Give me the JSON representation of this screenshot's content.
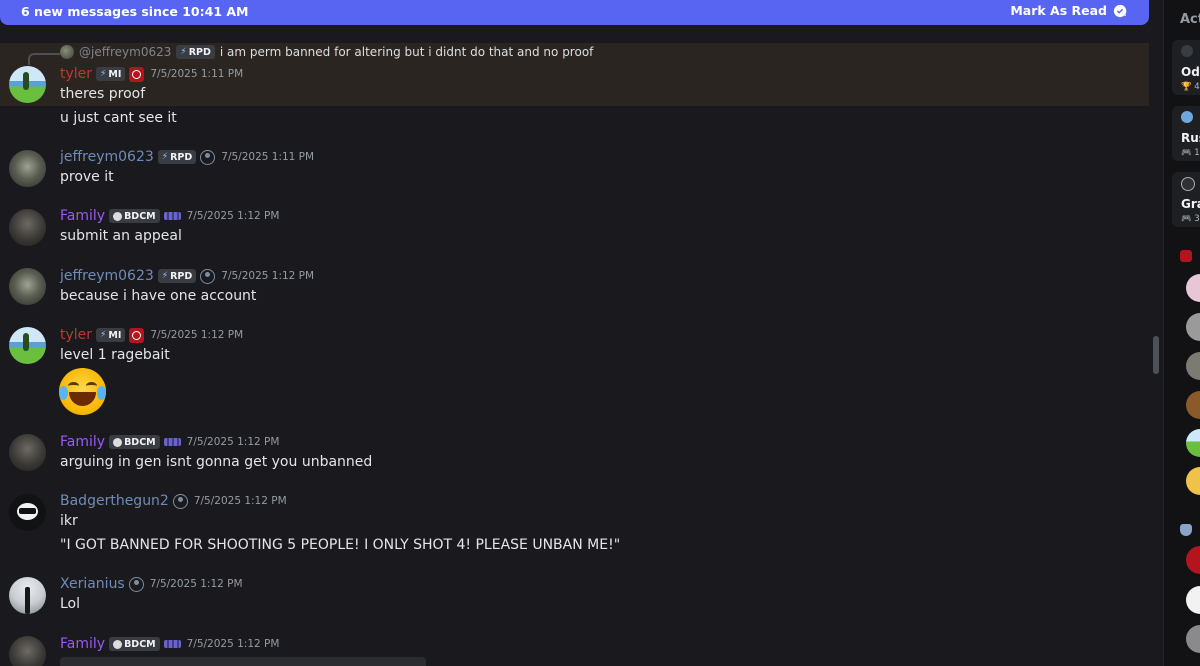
{
  "banner": {
    "text": "6 new messages since 10:41 AM",
    "action": "Mark As Read"
  },
  "reply": {
    "name": "@jeffreym0623",
    "tag": "RPD",
    "text": "i am perm banned for altering but i didnt do that and no proof"
  },
  "messages": [
    {
      "name": "tyler",
      "tag": "MI",
      "time": "7/5/2025 1:11 PM",
      "lines": [
        "theres proof",
        "u just cant see it"
      ]
    },
    {
      "name": "jeffreym0623",
      "tag": "RPD",
      "time": "7/5/2025 1:11 PM",
      "lines": [
        "prove it"
      ]
    },
    {
      "name": "Family",
      "tag": "BDCM",
      "time": "7/5/2025 1:12 PM",
      "lines": [
        "submit an appeal"
      ]
    },
    {
      "name": "jeffreym0623",
      "tag": "RPD",
      "time": "7/5/2025 1:12 PM",
      "lines": [
        "because i have one account"
      ]
    },
    {
      "name": "tyler",
      "tag": "MI",
      "time": "7/5/2025 1:12 PM",
      "lines": [
        "level 1 ragebait"
      ]
    },
    {
      "name": "Family",
      "tag": "BDCM",
      "time": "7/5/2025 1:12 PM",
      "lines": [
        "arguing in gen isnt gonna get you unbanned"
      ]
    },
    {
      "name": "Badgerthegun2",
      "tag": "",
      "time": "7/5/2025 1:12 PM",
      "lines": [
        "ikr",
        "\"I GOT BANNED FOR SHOOTING 5 PEOPLE! I ONLY SHOT 4! PLEASE UNBAN ME!\""
      ]
    },
    {
      "name": "Xerianius",
      "tag": "",
      "time": "7/5/2025 1:12 PM",
      "lines": [
        "Lol"
      ]
    },
    {
      "name": "Family",
      "tag": "BDCM",
      "time": "7/5/2025 1:12 PM",
      "lines": []
    }
  ],
  "sidebar": {
    "heading": "Acti",
    "cards": [
      {
        "title": "Ode",
        "sub": "4"
      },
      {
        "title": "Rus",
        "sub": "1"
      },
      {
        "title": "Gra",
        "sub": "3"
      }
    ],
    "colors": {
      "accent": "#5865f2",
      "tyler": "#c0392b",
      "family": "#9b59f5",
      "jeff": "#6f8cb8"
    }
  }
}
